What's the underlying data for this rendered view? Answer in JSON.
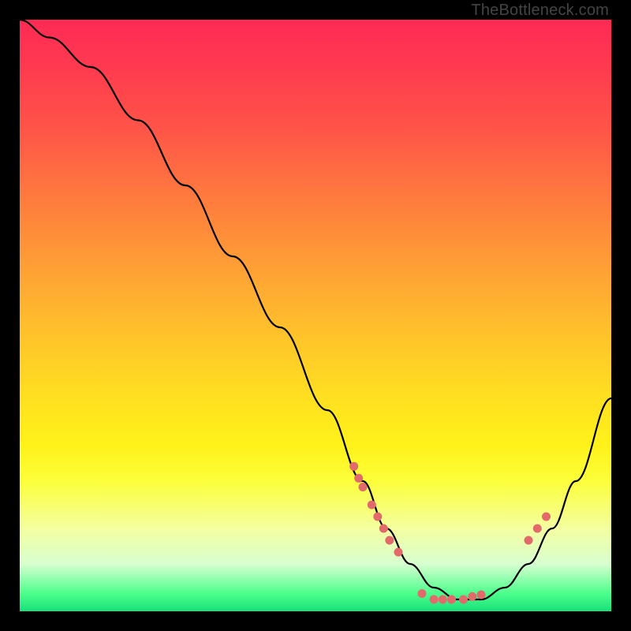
{
  "watermark": "TheBottleneck.com",
  "chart_data": {
    "type": "line",
    "title": "",
    "xlabel": "",
    "ylabel": "",
    "xlim": [
      0,
      100
    ],
    "ylim": [
      0,
      100
    ],
    "series": [
      {
        "name": "bottleneck-curve",
        "x": [
          0,
          5,
          12,
          20,
          28,
          36,
          44,
          52,
          58,
          62,
          66,
          70,
          74,
          78,
          82,
          86,
          90,
          94,
          100
        ],
        "values": [
          100,
          97,
          92,
          83,
          72,
          60,
          48,
          34,
          22,
          14,
          8,
          4,
          2,
          2,
          4,
          8,
          14,
          22,
          36
        ]
      }
    ],
    "markers": [
      {
        "x": 56.5,
        "y": 24.5
      },
      {
        "x": 57.3,
        "y": 22.5
      },
      {
        "x": 58.0,
        "y": 21.0
      },
      {
        "x": 59.5,
        "y": 18.0
      },
      {
        "x": 60.5,
        "y": 16.0
      },
      {
        "x": 61.5,
        "y": 14.0
      },
      {
        "x": 62.5,
        "y": 12.0
      },
      {
        "x": 64.0,
        "y": 10.0
      },
      {
        "x": 68.0,
        "y": 3.0
      },
      {
        "x": 70.0,
        "y": 2.0
      },
      {
        "x": 71.5,
        "y": 2.0
      },
      {
        "x": 73.0,
        "y": 2.0
      },
      {
        "x": 75.0,
        "y": 2.0
      },
      {
        "x": 76.5,
        "y": 2.5
      },
      {
        "x": 78.0,
        "y": 2.8
      },
      {
        "x": 86.0,
        "y": 12.0
      },
      {
        "x": 87.5,
        "y": 14.0
      },
      {
        "x": 89.0,
        "y": 16.0
      }
    ],
    "colors": {
      "curve_stroke": "#000000",
      "marker_fill": "#E26A6A"
    }
  }
}
